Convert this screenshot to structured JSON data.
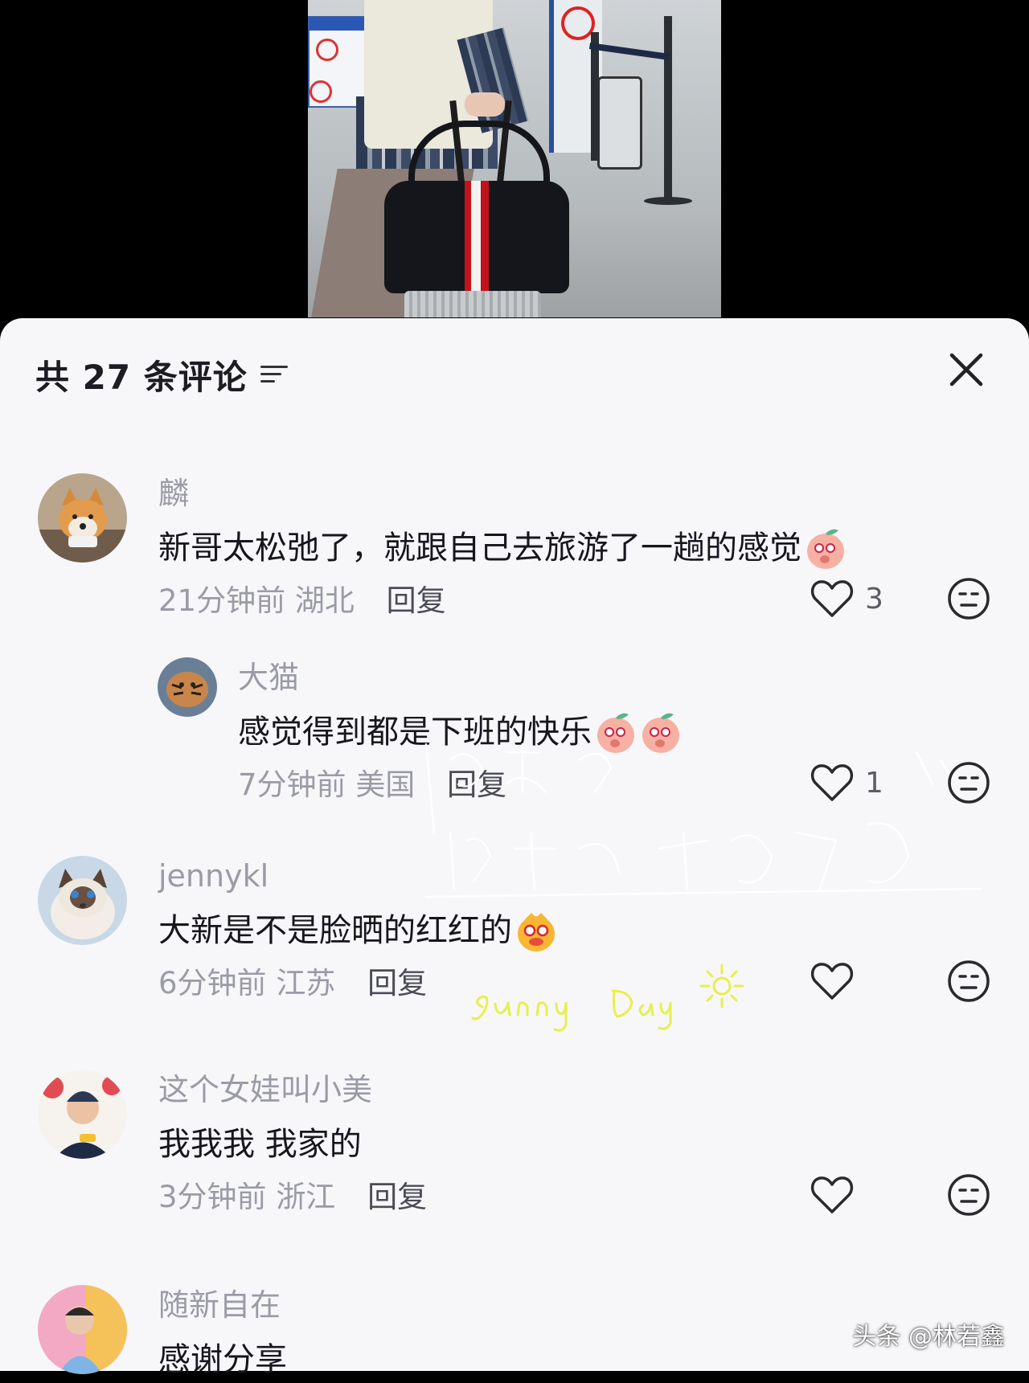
{
  "sheet": {
    "title": "共 27 条评论"
  },
  "comments": [
    {
      "name": "麟",
      "text": "新哥太松弛了，就跟自己去旅游了一趟的感觉",
      "time": "21分钟前",
      "location": "湖北",
      "reply_label": "回复",
      "likes": "3",
      "reply": {
        "name": "大猫",
        "text": "感觉得到都是下班的快乐",
        "time": "7分钟前",
        "location": "美国",
        "reply_label": "回复",
        "likes": "1"
      }
    },
    {
      "name": "jennykl",
      "text": "大新是不是脸晒的红红的",
      "time": "6分钟前",
      "location": "江苏",
      "reply_label": "回复",
      "likes": ""
    },
    {
      "name": "这个女娃叫小美",
      "text": "我我我 我家的",
      "time": "3分钟前",
      "location": "浙江",
      "reply_label": "回复",
      "likes": ""
    },
    {
      "name": "随新自在",
      "text": "感谢分享"
    }
  ],
  "overlay": {
    "sticker_text": "Sunny Day"
  },
  "watermark": "头条 @林若鑫",
  "icons": {
    "filter": "filter-icon",
    "close": "close-icon",
    "like": "heart-outline-icon",
    "dislike": "meh-face-icon",
    "emoji_blush": "blushing-peach-emoji",
    "emoji_red_face": "red-face-emoji"
  },
  "colors": {
    "sheet_bg": "#f7f7fa",
    "username": "#9a9ba5",
    "body_text": "#16161d",
    "sticker_yellow": "#e6f04a"
  }
}
